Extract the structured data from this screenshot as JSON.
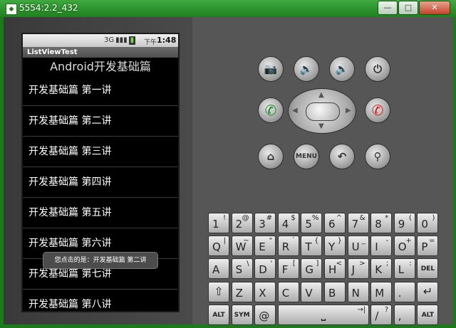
{
  "window": {
    "title": "5554:2.2_432",
    "icon": "app-icon",
    "buttons": {
      "minimize": "—",
      "maximize": "□",
      "close": "✕"
    }
  },
  "statusbar": {
    "icons": [
      "3G",
      "▮▮▮",
      "▮"
    ],
    "ampm": "下午",
    "time": "1:48"
  },
  "app": {
    "title": "ListViewTest",
    "header": "Android开发基础篇",
    "items": [
      "开发基础篇 第一讲",
      "开发基础篇 第二讲",
      "开发基础篇 第三讲",
      "开发基础篇 第四讲",
      "开发基础篇 第五讲",
      "开发基础篇 第六讲",
      "开发基础篇 第七讲",
      "开发基础篇 第八讲"
    ],
    "toast": "您点击的是：开发基础篇 第二讲"
  },
  "controls": {
    "camera": "📷",
    "vol_down": "🔉",
    "vol_up": "🔊",
    "power": "⏻",
    "call": "✆",
    "end": "✆",
    "home": "⌂",
    "menu": "MENU",
    "back": "↶",
    "search": "⚲",
    "dpad": {
      "up": "▲",
      "down": "▼",
      "left": "◀",
      "right": "▶"
    }
  },
  "keyboard": {
    "row1": [
      {
        "m": "1",
        "a": "!"
      },
      {
        "m": "2",
        "a": "@"
      },
      {
        "m": "3",
        "a": "#"
      },
      {
        "m": "4",
        "a": "$"
      },
      {
        "m": "5",
        "a": "%"
      },
      {
        "m": "6",
        "a": "^"
      },
      {
        "m": "7",
        "a": "&"
      },
      {
        "m": "8",
        "a": "*"
      },
      {
        "m": "9",
        "a": "("
      },
      {
        "m": "0",
        "a": ")"
      }
    ],
    "row2": [
      {
        "m": "Q",
        "a": "|"
      },
      {
        "m": "W",
        "a": "~"
      },
      {
        "m": "E",
        "a": "\""
      },
      {
        "m": "R",
        "a": "`"
      },
      {
        "m": "T",
        "a": "{"
      },
      {
        "m": "Y",
        "a": "}"
      },
      {
        "m": "U",
        "a": "_"
      },
      {
        "m": "I",
        "a": "-"
      },
      {
        "m": "O",
        "a": "+"
      },
      {
        "m": "P",
        "a": "="
      }
    ],
    "row3": [
      {
        "m": "A",
        "a": ""
      },
      {
        "m": "S",
        "a": "\\"
      },
      {
        "m": "D",
        "a": "'"
      },
      {
        "m": "F",
        "a": "["
      },
      {
        "m": "G",
        "a": "]"
      },
      {
        "m": "H",
        "a": "<"
      },
      {
        "m": "J",
        "a": ">"
      },
      {
        "m": "K",
        "a": ";"
      },
      {
        "m": "L",
        "a": ":"
      },
      {
        "m": "",
        "a": "",
        "special": "DEL"
      }
    ],
    "row4": [
      {
        "m": "⇧",
        "a": "",
        "glyph": true
      },
      {
        "m": "Z",
        "a": ""
      },
      {
        "m": "X",
        "a": ""
      },
      {
        "m": "C",
        "a": ""
      },
      {
        "m": "V",
        "a": ""
      },
      {
        "m": "B",
        "a": ""
      },
      {
        "m": "N",
        "a": ""
      },
      {
        "m": "M",
        "a": ""
      },
      {
        "m": ".",
        "a": ""
      },
      {
        "m": "↵",
        "a": "",
        "glyph": true
      }
    ],
    "row5": {
      "alt_left": "ALT",
      "sym": "SYM",
      "at": "@",
      "space": "⎵",
      "space_arrow": "→|",
      "slash": "/",
      "question": "?",
      "comma": ",",
      "alt_right": "ALT"
    }
  }
}
